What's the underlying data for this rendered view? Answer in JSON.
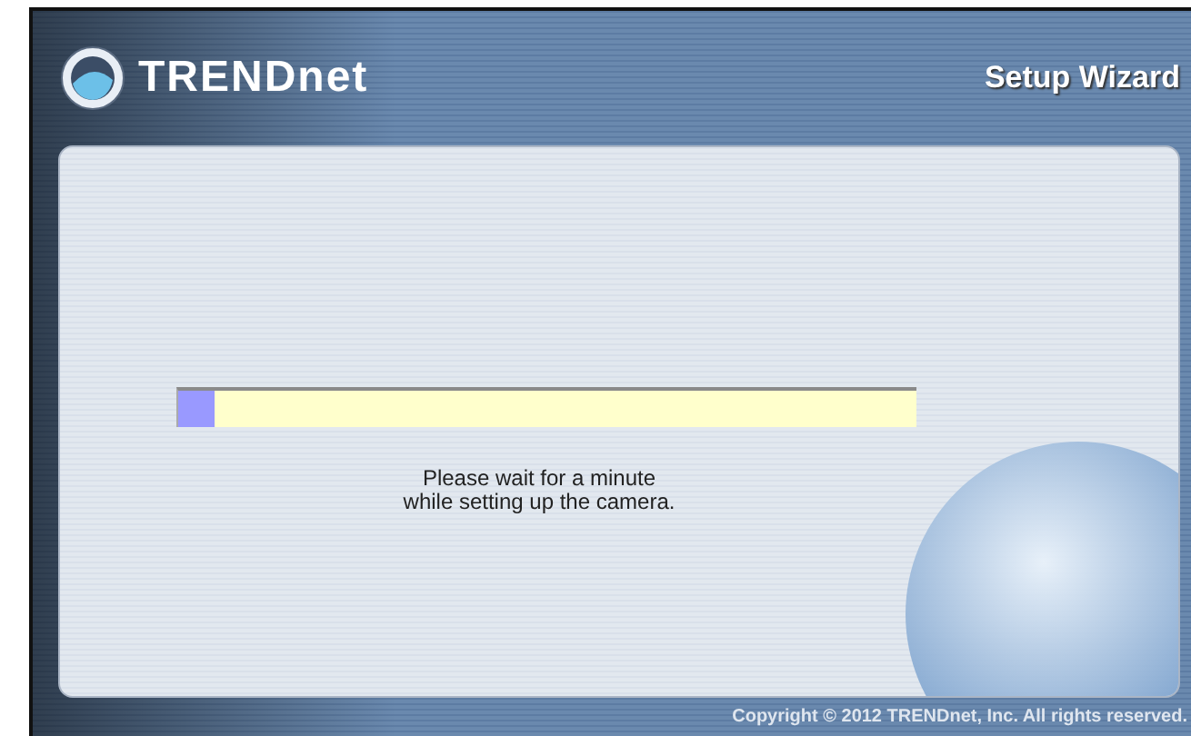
{
  "header": {
    "logo": "TRENDnet",
    "title": "Setup Wizard"
  },
  "progress": {
    "level": 0.05
  },
  "message": [
    "Please wait for a minute",
    "while setting up the camera."
  ],
  "footer": "Copyright © 2012 TRENDnet, Inc. All rights reserved."
}
